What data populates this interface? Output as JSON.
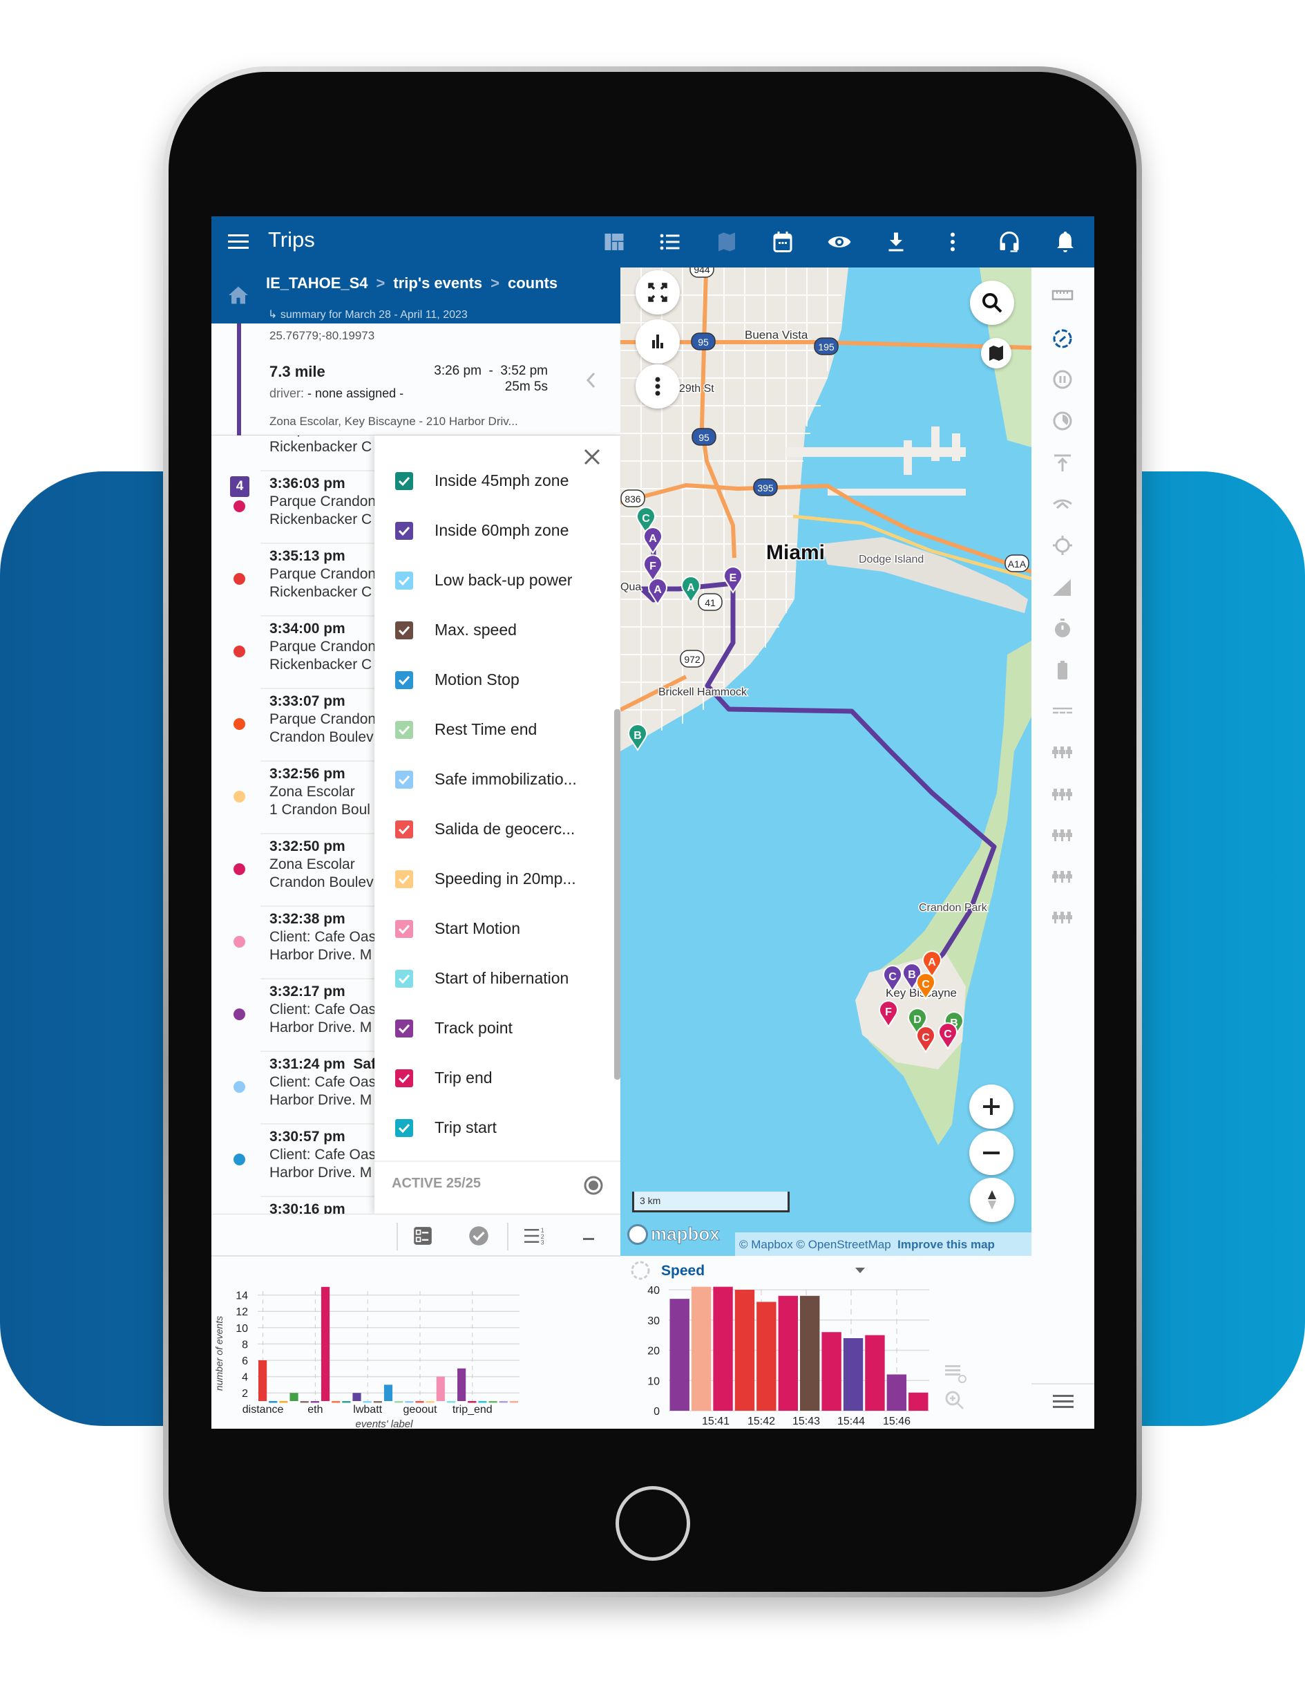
{
  "app": {
    "title": "Trips",
    "accent": "#07589a"
  },
  "toolbar_icons": [
    "dashboard-icon",
    "list-icon",
    "map-icon",
    "calendar-icon",
    "eye-icon",
    "download-icon",
    "more-vert-icon",
    "headset-icon",
    "bell-icon"
  ],
  "breadcrumb": {
    "items": [
      "IE_TAHOE_S4",
      "trip's events",
      "counts"
    ],
    "subtitle": "summary for March 28 - April 11, 2023"
  },
  "trip": {
    "coords": "25.76779;-80.19973",
    "number": "4",
    "distance": "7.3 mile",
    "driver_label": "driver:",
    "driver_value": "- none assigned -",
    "time_range": "3:26 pm  -  3:52 pm",
    "duration": "25m 5s",
    "address": "Zona Escolar, Key Biscayne - 210 Harbor Driv..."
  },
  "events": [
    {
      "time": "",
      "event": "",
      "line1": "Parque Crandon",
      "line2": "Rickenbacker C",
      "color": ""
    },
    {
      "time": "3:36:03 pm",
      "event": "",
      "line1": "Parque Crandon",
      "line2": "Rickenbacker C",
      "color": "#d81b60"
    },
    {
      "time": "3:35:13 pm",
      "event": "",
      "line1": "Parque Crandon",
      "line2": "Rickenbacker C",
      "color": "#e53935"
    },
    {
      "time": "3:34:00 pm",
      "event": "",
      "line1": "Parque Crandon",
      "line2": "Rickenbacker C",
      "color": "#e53935"
    },
    {
      "time": "3:33:07 pm",
      "event": "",
      "line1": "Parque Crandon",
      "line2": "Crandon Boulev",
      "color": "#f4511e"
    },
    {
      "time": "3:32:56 pm",
      "event": "",
      "line1": "Zona Escolar",
      "line2": "1 Crandon Boul",
      "color": "#ffcc80"
    },
    {
      "time": "3:32:50 pm",
      "event": "",
      "line1": "Zona Escolar",
      "line2": "Crandon Boulev",
      "color": "#d81b60"
    },
    {
      "time": "3:32:38 pm",
      "event": "",
      "line1": "Client: Cafe Oas",
      "line2": "Harbor Drive. M",
      "color": "#f48fb1"
    },
    {
      "time": "3:32:17 pm",
      "event": "",
      "line1": "Client: Cafe Oas",
      "line2": "Harbor Drive. M",
      "color": "#883997"
    },
    {
      "time": "3:31:24 pm",
      "event": "Saf",
      "line1": "Client: Cafe Oas",
      "line2": "Harbor Drive. M",
      "color": "#90caf9"
    },
    {
      "time": "3:30:57 pm",
      "event": "",
      "line1": "Client: Cafe Oas",
      "line2": "Harbor Drive. M",
      "color": "#2196d3"
    },
    {
      "time": "3:30:16 pm",
      "event": "",
      "line1": "",
      "line2": "",
      "color": ""
    }
  ],
  "filter": {
    "items": [
      {
        "label": "Inside 45mph zone",
        "color": "#138a7a",
        "checked": true
      },
      {
        "label": "Inside 60mph zone",
        "color": "#5e44a0",
        "checked": true
      },
      {
        "label": "Low back-up power",
        "color": "#81d4fa",
        "checked": true
      },
      {
        "label": "Max. speed",
        "color": "#6d4c41",
        "checked": true
      },
      {
        "label": "Motion Stop",
        "color": "#2a96d6",
        "checked": true
      },
      {
        "label": "Rest Time end",
        "color": "#a5d6a7",
        "checked": true
      },
      {
        "label": "Safe immobilizatio...",
        "color": "#90caf9",
        "checked": true
      },
      {
        "label": "Salida de geocerc...",
        "color": "#ef5350",
        "checked": true
      },
      {
        "label": "Speeding in 20mp...",
        "color": "#ffcc80",
        "checked": true
      },
      {
        "label": "Start Motion",
        "color": "#f48fb1",
        "checked": true
      },
      {
        "label": "Start of hibernation",
        "color": "#80deea",
        "checked": true
      },
      {
        "label": "Track point",
        "color": "#883997",
        "checked": true
      },
      {
        "label": "Trip end",
        "color": "#d81b60",
        "checked": true
      },
      {
        "label": "Trip start",
        "color": "#12acc4",
        "checked": true
      }
    ],
    "active_label": "ACTIVE 25/25"
  },
  "map": {
    "labels": [
      "Miami",
      "Buena Vista",
      "Dodge Island",
      "Brickell Hammock",
      "Crandon Park",
      "Key Biscayne",
      "29th St",
      "Qua"
    ],
    "shields": [
      "95",
      "195",
      "395",
      "836",
      "41",
      "972",
      "944",
      "A1A",
      "95"
    ],
    "markers": [
      {
        "letter": "C",
        "color": "#1e9a7a"
      },
      {
        "letter": "A",
        "color": "#6a3fa8"
      },
      {
        "letter": "F",
        "color": "#6a3fa8"
      },
      {
        "letter": "A",
        "color": "#6a3fa8"
      },
      {
        "letter": "A",
        "color": "#1e9a7a"
      },
      {
        "letter": "E",
        "color": "#6a3fa8"
      },
      {
        "letter": "B",
        "color": "#1e9a7a"
      },
      {
        "letter": "A",
        "color": "#f4511e"
      },
      {
        "letter": "B",
        "color": "#6a3fa8"
      },
      {
        "letter": "C",
        "color": "#6a3fa8"
      },
      {
        "letter": "C",
        "color": "#f57c00"
      },
      {
        "letter": "F",
        "color": "#d81b60"
      },
      {
        "letter": "D",
        "color": "#43a047"
      },
      {
        "letter": "B",
        "color": "#43a047"
      },
      {
        "letter": "C",
        "color": "#e53935"
      },
      {
        "letter": "C",
        "color": "#d81b60"
      }
    ],
    "scale": "3 km",
    "logo": "mapbox",
    "attribution": "© Mapbox © OpenStreetMap",
    "improve": "Improve this map",
    "route_color": "#5e3d9a"
  },
  "chart_data": [
    {
      "type": "bar",
      "xlabel": "events' label",
      "ylabel": "number of events",
      "ylim": [
        1,
        15
      ],
      "yticks": [
        2,
        4,
        6,
        8,
        10,
        12,
        14
      ],
      "tick_labels": [
        "distance",
        "eth",
        "lwbatt",
        "geoout",
        "trip_end"
      ],
      "tick_positions": [
        0,
        5,
        10,
        15,
        20
      ],
      "grid": true,
      "values": [
        6,
        1,
        1,
        2,
        1,
        1,
        15,
        1,
        1,
        2,
        1,
        1,
        3,
        1,
        1,
        1,
        1,
        4,
        1,
        5,
        1,
        1,
        1,
        1,
        1
      ],
      "colors": [
        "#e53935",
        "#2196d3",
        "#ffa726",
        "#43a047",
        "#8d6e63",
        "#8e44ad",
        "#d81b60",
        "#ff7043",
        "#26a69a",
        "#5e44a0",
        "#81d4fa",
        "#8d6e63",
        "#2a96d6",
        "#a5d6a7",
        "#90caf9",
        "#ef5350",
        "#ffcc80",
        "#f48fb1",
        "#80deea",
        "#883997",
        "#d81b60",
        "#26c6da",
        "#66bb6a",
        "#b39ddb",
        "#ffab91"
      ]
    },
    {
      "type": "bar",
      "title": "Speed",
      "ylim": [
        0,
        42
      ],
      "yticks": [
        0,
        10,
        20,
        30,
        40
      ],
      "tick_labels": [
        "15:41",
        "15:42",
        "15:43",
        "15:44",
        "15:46"
      ],
      "grid": true,
      "values": [
        37,
        41,
        41,
        40,
        36,
        38,
        38,
        26,
        24,
        25,
        12,
        6
      ],
      "colors": [
        "#883997",
        "#f7a98f",
        "#d81b60",
        "#e53935",
        "#e53935",
        "#d81b60",
        "#6d4c41",
        "#d81b60",
        "#5e44a0",
        "#d81b60",
        "#883997",
        "#d81b60"
      ]
    }
  ],
  "sidebar_icons": [
    "ruler-icon",
    "speed-gauge-icon",
    "pause-circle-icon",
    "pie-clock-icon",
    "upload-arrow-icon",
    "signal-icon",
    "gps-target-icon",
    "cell-signal-icon",
    "stopwatch-icon",
    "battery-icon",
    "lines-icon",
    "sensor-icon",
    "sensor-icon",
    "sensor-icon",
    "sensor-icon",
    "sensor-icon"
  ],
  "bottom_toolbar_icons": [
    "checklist-icon",
    "check-circle-icon",
    "numbered-list-icon",
    "minimize-icon"
  ]
}
